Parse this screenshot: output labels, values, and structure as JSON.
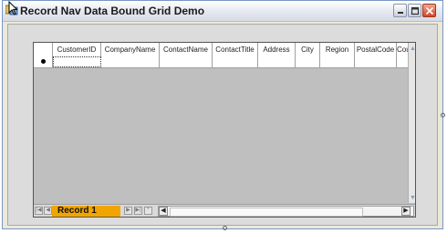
{
  "window": {
    "title": "Record Nav Data Bound Grid Demo",
    "controls": {
      "minimize": "minimize",
      "maximize": "maximize",
      "close": "close"
    }
  },
  "grid": {
    "columns": [
      "CustomerID",
      "CompanyName",
      "ContactName",
      "ContactTitle",
      "Address",
      "City",
      "Region",
      "PostalCode",
      "Cou"
    ],
    "rows": [
      [
        "",
        "",
        "",
        "",
        "",
        "",
        "",
        "",
        ""
      ]
    ]
  },
  "navigator": {
    "record_label": "Record 1",
    "buttons": [
      "first",
      "previous",
      "next",
      "last",
      "new"
    ]
  },
  "colors": {
    "accent": "#f1a500",
    "title_bar": "#d6dbe6",
    "client": "#dcdcdc"
  }
}
